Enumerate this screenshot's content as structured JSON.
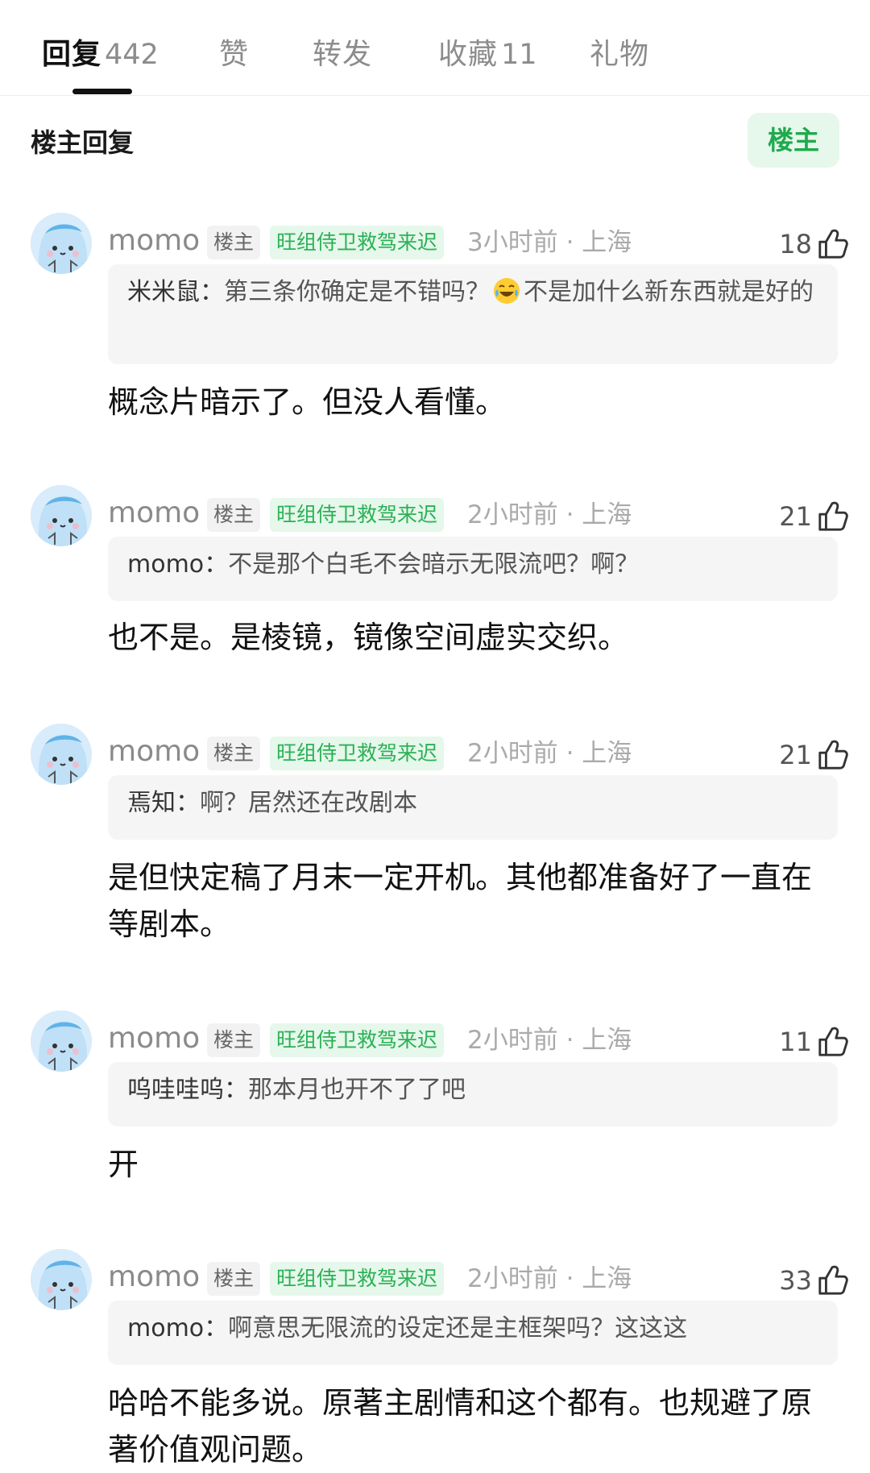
{
  "tabs": [
    {
      "label": "回复",
      "count": "442",
      "active": true
    },
    {
      "label": "赞",
      "count": ""
    },
    {
      "label": "转发",
      "count": ""
    },
    {
      "label": "收藏",
      "count": "11"
    },
    {
      "label": "礼物",
      "count": ""
    }
  ],
  "section": {
    "title": "楼主回复",
    "filter_label": "楼主"
  },
  "badges": {
    "op": "楼主",
    "title": "旺组侍卫救驾来迟"
  },
  "comments": [
    {
      "username": "momo",
      "time_loc": "3小时前 · 上海",
      "likes": "18",
      "quote_name": "米米鼠：",
      "quote_text": "第三条你确定是不错吗？",
      "quote_emoji": "laughing-crying-emoji",
      "quote_text2": "不是加什么新东西就是好的",
      "reply": "概念片暗示了。但没人看懂。"
    },
    {
      "username": "momo",
      "time_loc": "2小时前 · 上海",
      "likes": "21",
      "quote_name": "momo：",
      "quote_text": "不是那个白毛不会暗示无限流吧？啊？",
      "reply": "也不是。是棱镜，镜像空间虚实交织。"
    },
    {
      "username": "momo",
      "time_loc": "2小时前 · 上海",
      "likes": "21",
      "quote_name": "焉知：",
      "quote_text": "啊？居然还在改剧本",
      "reply": "是但快定稿了月末一定开机。其他都准备好了一直在等剧本。"
    },
    {
      "username": "momo",
      "time_loc": "2小时前 · 上海",
      "likes": "11",
      "quote_name": "呜哇哇呜：",
      "quote_text": "那本月也开不了了吧",
      "reply": "开"
    },
    {
      "username": "momo",
      "time_loc": "2小时前 · 上海",
      "likes": "33",
      "quote_name": "momo：",
      "quote_text": "啊意思无限流的设定还是主框架吗？这这这",
      "reply": "哈哈不能多说。原著主剧情和这个都有。也规避了原著价值观问题。"
    }
  ],
  "colors": {
    "accent_green": "#1faa4c",
    "badge_green_bg": "#e6f7eb",
    "quote_bg": "#f5f5f5"
  }
}
